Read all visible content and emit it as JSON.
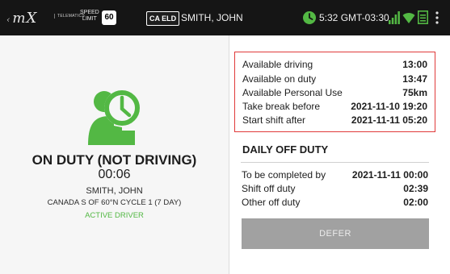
{
  "topbar": {
    "telematics": "TELEMATICS",
    "speed_label_line1": "SPEED",
    "speed_label_line2": "LIMIT",
    "speed_value": "60",
    "eld_badge": "CA ELD",
    "driver": "SMITH, JOHN",
    "time": "5:32 GMT-03:30",
    "icons": [
      "clock-icon",
      "signal-icon",
      "wifi-icon",
      "document-icon",
      "more-vert-icon"
    ],
    "colors": {
      "accent": "#53b844",
      "bar": "#151515"
    }
  },
  "status": {
    "title": "ON DUTY (NOT DRIVING)",
    "time": "00:06",
    "driver": "SMITH, JOHN",
    "cycle": "CANADA S OF 60°N CYCLE 1 (7 DAY)",
    "active": "ACTIVE DRIVER",
    "icon": "driver-clock-icon",
    "color": "#53b844"
  },
  "availability": [
    {
      "label": "Available driving",
      "value": "13:00"
    },
    {
      "label": "Available on duty",
      "value": "13:47"
    },
    {
      "label": "Available Personal Use",
      "value": "75km"
    },
    {
      "label": "Take break before",
      "value": "2021-11-10 19:20"
    },
    {
      "label": "Start shift after",
      "value": "2021-11-11 05:20"
    }
  ],
  "daily_off": {
    "title": "DAILY OFF DUTY",
    "rows": [
      {
        "label": "To be completed by",
        "value": "2021-11-11 00:00"
      },
      {
        "label": "Shift off duty",
        "value": "02:39"
      },
      {
        "label": "Other off duty",
        "value": "02:00"
      }
    ],
    "defer_label": "DEFER"
  }
}
